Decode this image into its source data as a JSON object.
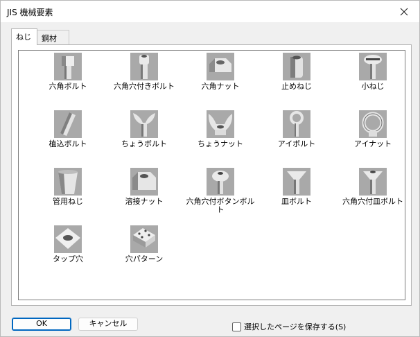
{
  "window": {
    "title": "JIS 機械要素"
  },
  "tabs": [
    {
      "label": "ねじ",
      "active": true
    },
    {
      "label": "鋼材",
      "active": false
    }
  ],
  "items": [
    {
      "label": "六角ボルト",
      "icon": "hex-bolt-icon"
    },
    {
      "label": "六角穴付きボルト",
      "icon": "socket-head-bolt-icon"
    },
    {
      "label": "六角ナット",
      "icon": "hex-nut-icon"
    },
    {
      "label": "止めねじ",
      "icon": "set-screw-icon"
    },
    {
      "label": "小ねじ",
      "icon": "machine-screw-icon"
    },
    {
      "label": "植込ボルト",
      "icon": "stud-bolt-icon"
    },
    {
      "label": "ちょうボルト",
      "icon": "wing-bolt-icon"
    },
    {
      "label": "ちょうナット",
      "icon": "wing-nut-icon"
    },
    {
      "label": "アイボルト",
      "icon": "eye-bolt-icon"
    },
    {
      "label": "アイナット",
      "icon": "eye-nut-icon"
    },
    {
      "label": "管用ねじ",
      "icon": "pipe-thread-icon"
    },
    {
      "label": "溶接ナット",
      "icon": "weld-nut-icon"
    },
    {
      "label": "六角穴付ボタンボルト",
      "icon": "button-head-bolt-icon"
    },
    {
      "label": "皿ボルト",
      "icon": "countersunk-bolt-icon"
    },
    {
      "label": "六角穴付皿ボルト",
      "icon": "socket-countersunk-bolt-icon"
    },
    {
      "label": "タップ穴",
      "icon": "tapped-hole-icon"
    },
    {
      "label": "穴パターン",
      "icon": "hole-pattern-icon"
    }
  ],
  "buttons": {
    "ok": "OK",
    "cancel": "キャンセル"
  },
  "checkbox": {
    "label": "選択したページを保存する(S)",
    "checked": false
  }
}
